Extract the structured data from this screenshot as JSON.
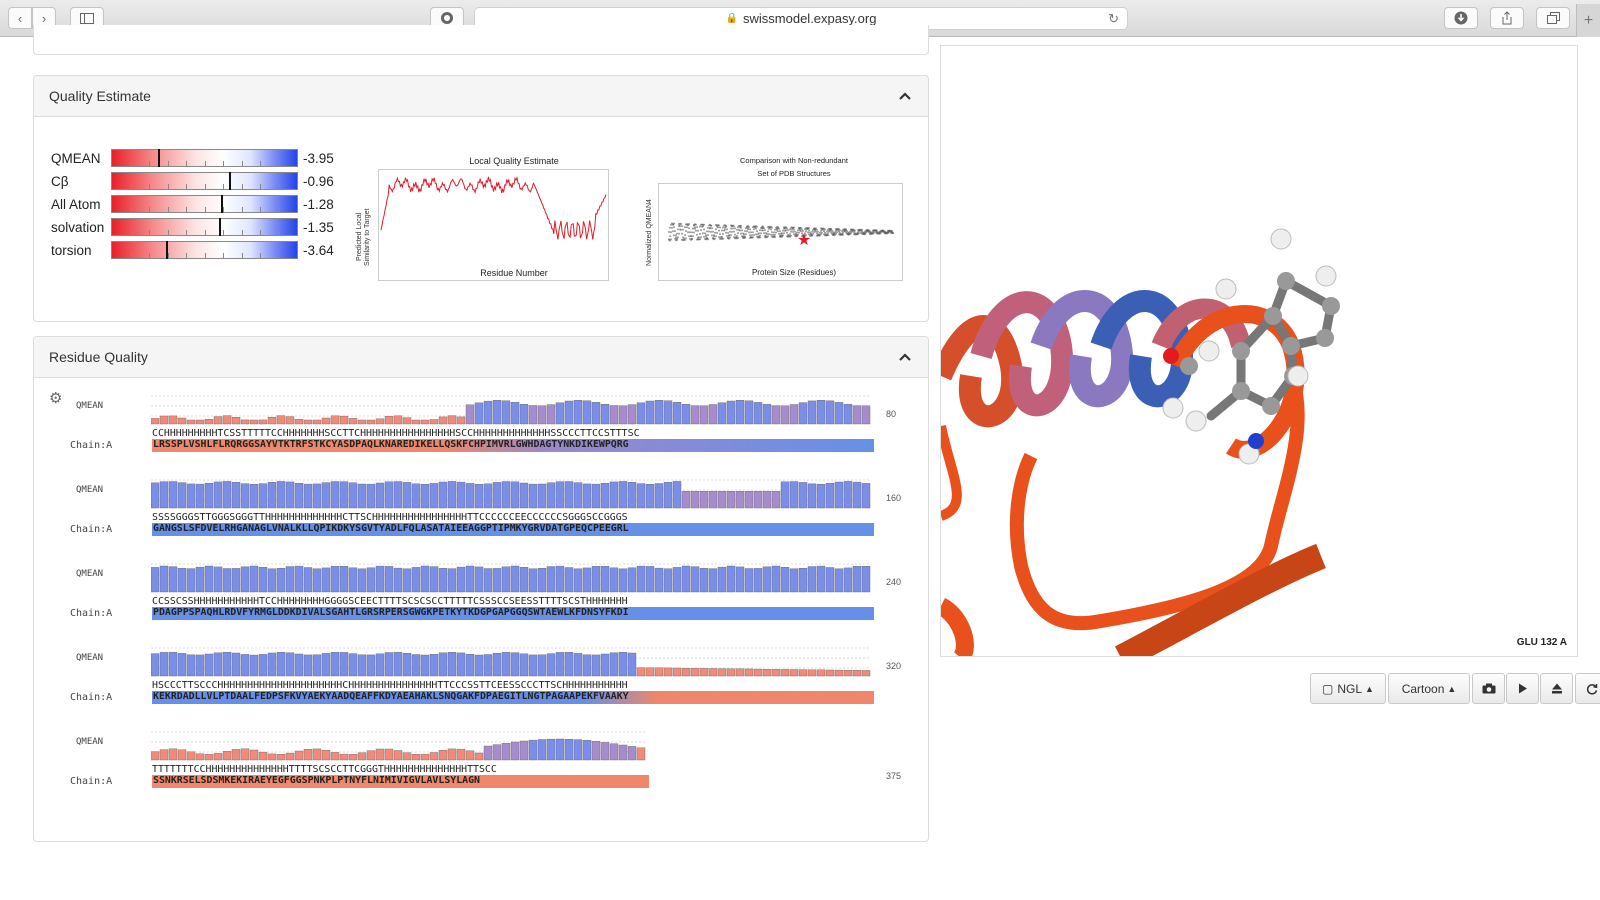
{
  "browser": {
    "url": "swissmodel.expasy.org",
    "icons": [
      "back-icon",
      "forward-icon",
      "sidebar-icon",
      "extension-icon",
      "lock-icon",
      "reload-icon",
      "download-icon",
      "share-icon",
      "tabs-icon",
      "new-tab-icon"
    ]
  },
  "quality": {
    "title": "Quality Estimate",
    "scores": [
      {
        "label": "QMEAN",
        "value": "-3.95",
        "marker": 0.25
      },
      {
        "label": "Cβ",
        "value": "-0.96",
        "marker": 0.63
      },
      {
        "label": "All Atom",
        "value": "-1.28",
        "marker": 0.59
      },
      {
        "label": "solvation",
        "value": "-1.35",
        "marker": 0.58
      },
      {
        "label": "torsion",
        "value": "-3.64",
        "marker": 0.29
      }
    ],
    "local_plot": {
      "title": "Local Quality Estimate",
      "xlabel": "Residue Number",
      "ylabel_line1": "Predicted Local",
      "ylabel_line2": "Similarity to Target"
    },
    "compare_plot": {
      "title_line1": "Comparison with Non-redundant",
      "title_line2": "Set of PDB Structures",
      "xlabel": "Protein Size (Residues)",
      "ylabel": "Normalized QMEAN4"
    }
  },
  "residue": {
    "title": "Residue Quality",
    "qmean_label": "QMEAN",
    "blocks": [
      {
        "chain": "Chain:A",
        "ss": "CCHHHHHHHHHTCSSTTTTTCCHHHHHHHSCCTTCHHHHHHHHHHHHHHHHSCCHHHHHHHHHHHHHSSCCCTTCCSTTTSC",
        "seq": "LRSSPLVSHLFLRQRGGSAYVTKTRFSTKCYASDPAQLKNAREDIKELLQSKFCHPIMVRLGWHDAGTYNKDIKEWPQRG",
        "end": "80"
      },
      {
        "chain": "Chain:A",
        "ss": "SSSSGGGSTTGGGSGGGTTHHHHHHHHHHHHHCTTSCHHHHHHHHHHHHHHHHTTCCCCCCEECCCCCCSGGGSCCGGGS",
        "seq": "GANGSLSFDVELRHGANAGLVNALKLLQPIKDKYSGVTYADLFQLASATAIEEAGGPTIPMKYGRVDATGPEQCPEEGRL",
        "end": "160"
      },
      {
        "chain": "Chain:A",
        "ss": "CCSSCSSHHHHHHHHHHHTCCHHHHHHHHGGGGSCEECTTTTSCSCSCCTTTTTCSSSCCSEESSTTTTSCSTHHHHHHH",
        "seq": "PDAGPPSPAQHLRDVFYRMGLDDKDIVALSGAHTLGRSRPERSGWGKPETKYTKDGPGAPGGQSWTAEWLKFDNSYFKDI",
        "end": "240"
      },
      {
        "chain": "Chain:A",
        "ss": "HSCCCTTSCCCHHHHHHHHHHHHHHHHHHHHHCHHHHHHHHHHHHHHHTTCCCSSTTCEESSCCCTTSCHHHHHHHHHHH",
        "seq": "KEKRDADLLVLPTDAALFEDPSFKVYAEKYAADQEAFFKDYAEAHAKLSNQGAKFDPAEGITLNGTPAGAAPEKFVAAKY",
        "end": "320"
      },
      {
        "chain": "Chain:A",
        "ss": "TTTTTTTCCHHHHHHHHHHHHHHTTTTSCSCCTTCGGGTHHHHHHHHHHHHHHTTSCC",
        "seq": "SSNKRSELSDSMKEKIRAEYEGFGGSPNKPLPTNYFLNIMIVIGVLAVLSYLAGN",
        "end": "375"
      }
    ]
  },
  "viewer": {
    "residue_label": "GLU 132 A",
    "engine": "NGL",
    "style": "Cartoon",
    "icons": [
      "camera-icon",
      "play-icon",
      "eject-icon",
      "refresh-icon"
    ]
  },
  "colors": {
    "low": "#f0876a",
    "mid": "#9a88cc",
    "high": "#6690e8",
    "ribbon": "#e8501c",
    "helix_blue": "#3b5fb5"
  }
}
